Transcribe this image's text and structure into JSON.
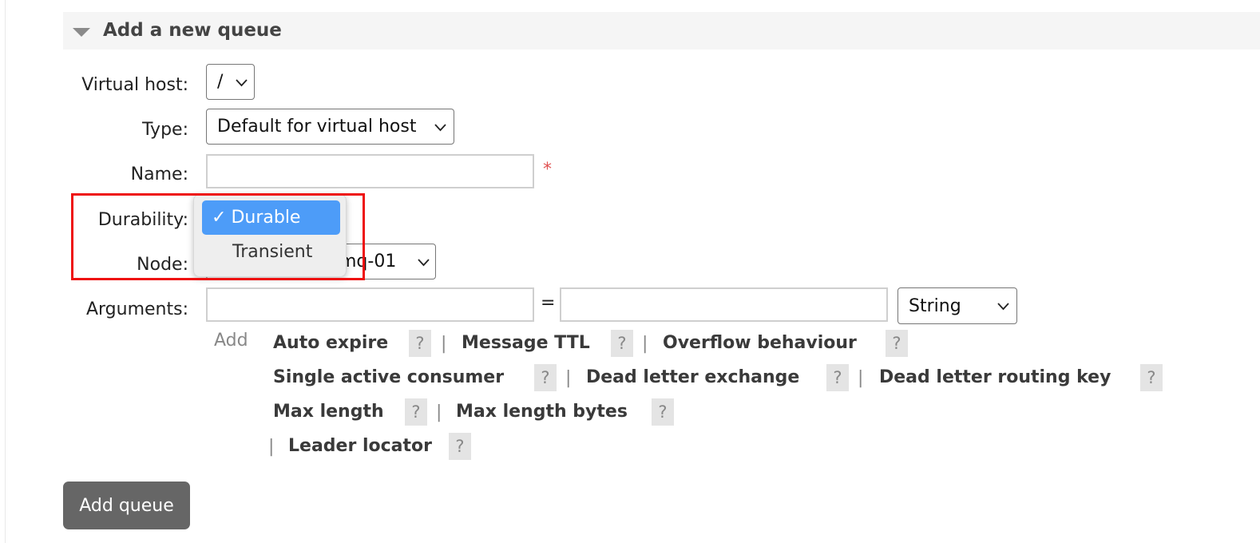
{
  "section": {
    "title": "Add a new queue"
  },
  "form": {
    "virtual_host": {
      "label": "Virtual host:",
      "value": "/"
    },
    "type": {
      "label": "Type:",
      "value": "Default for virtual host"
    },
    "name": {
      "label": "Name:",
      "value": "",
      "required_marker": "*"
    },
    "durability": {
      "label": "Durability:",
      "options": [
        {
          "label": "Durable",
          "selected": true,
          "check": "✓"
        },
        {
          "label": "Transient",
          "selected": false
        }
      ]
    },
    "node": {
      "label": "Node:",
      "value_visible": "mq-01"
    },
    "arguments": {
      "label": "Arguments:",
      "key_value": "",
      "value_value": "",
      "equals": "=",
      "type_value": "String",
      "add_label": "Add",
      "help_glyph": "?",
      "separator": "|",
      "links": [
        "Auto expire",
        "Message TTL",
        "Overflow behaviour",
        "Single active consumer",
        "Dead letter exchange",
        "Dead letter routing key",
        "Max length",
        "Max length bytes",
        "Leader locator"
      ]
    }
  },
  "actions": {
    "add_queue_label": "Add queue"
  },
  "colors": {
    "highlight": "#ee1111",
    "selected_option": "#4d9cf8",
    "button_bg": "#666666",
    "required": "#e05252"
  }
}
